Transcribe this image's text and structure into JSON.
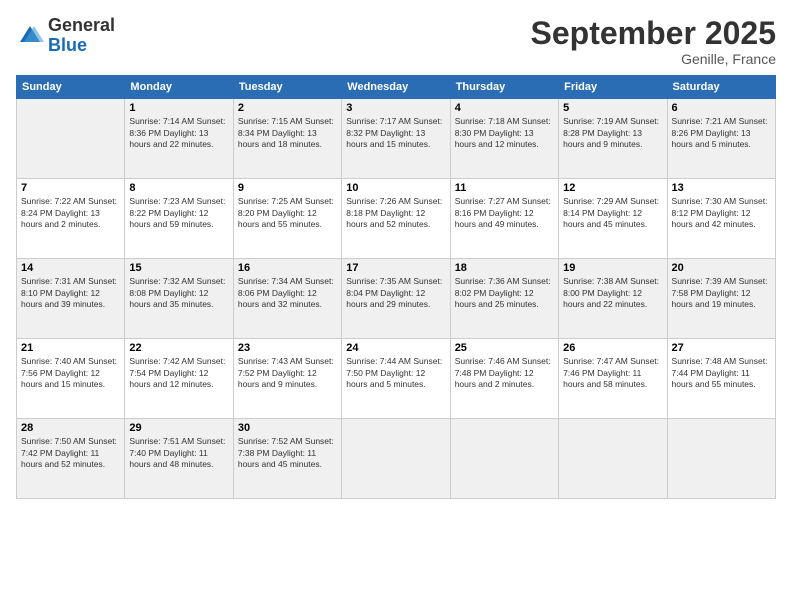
{
  "logo": {
    "general": "General",
    "blue": "Blue"
  },
  "title": "September 2025",
  "subtitle": "Genille, France",
  "days_of_week": [
    "Sunday",
    "Monday",
    "Tuesday",
    "Wednesday",
    "Thursday",
    "Friday",
    "Saturday"
  ],
  "weeks": [
    [
      {
        "day": "",
        "info": ""
      },
      {
        "day": "1",
        "info": "Sunrise: 7:14 AM\nSunset: 8:36 PM\nDaylight: 13 hours\nand 22 minutes."
      },
      {
        "day": "2",
        "info": "Sunrise: 7:15 AM\nSunset: 8:34 PM\nDaylight: 13 hours\nand 18 minutes."
      },
      {
        "day": "3",
        "info": "Sunrise: 7:17 AM\nSunset: 8:32 PM\nDaylight: 13 hours\nand 15 minutes."
      },
      {
        "day": "4",
        "info": "Sunrise: 7:18 AM\nSunset: 8:30 PM\nDaylight: 13 hours\nand 12 minutes."
      },
      {
        "day": "5",
        "info": "Sunrise: 7:19 AM\nSunset: 8:28 PM\nDaylight: 13 hours\nand 9 minutes."
      },
      {
        "day": "6",
        "info": "Sunrise: 7:21 AM\nSunset: 8:26 PM\nDaylight: 13 hours\nand 5 minutes."
      }
    ],
    [
      {
        "day": "7",
        "info": "Sunrise: 7:22 AM\nSunset: 8:24 PM\nDaylight: 13 hours\nand 2 minutes."
      },
      {
        "day": "8",
        "info": "Sunrise: 7:23 AM\nSunset: 8:22 PM\nDaylight: 12 hours\nand 59 minutes."
      },
      {
        "day": "9",
        "info": "Sunrise: 7:25 AM\nSunset: 8:20 PM\nDaylight: 12 hours\nand 55 minutes."
      },
      {
        "day": "10",
        "info": "Sunrise: 7:26 AM\nSunset: 8:18 PM\nDaylight: 12 hours\nand 52 minutes."
      },
      {
        "day": "11",
        "info": "Sunrise: 7:27 AM\nSunset: 8:16 PM\nDaylight: 12 hours\nand 49 minutes."
      },
      {
        "day": "12",
        "info": "Sunrise: 7:29 AM\nSunset: 8:14 PM\nDaylight: 12 hours\nand 45 minutes."
      },
      {
        "day": "13",
        "info": "Sunrise: 7:30 AM\nSunset: 8:12 PM\nDaylight: 12 hours\nand 42 minutes."
      }
    ],
    [
      {
        "day": "14",
        "info": "Sunrise: 7:31 AM\nSunset: 8:10 PM\nDaylight: 12 hours\nand 39 minutes."
      },
      {
        "day": "15",
        "info": "Sunrise: 7:32 AM\nSunset: 8:08 PM\nDaylight: 12 hours\nand 35 minutes."
      },
      {
        "day": "16",
        "info": "Sunrise: 7:34 AM\nSunset: 8:06 PM\nDaylight: 12 hours\nand 32 minutes."
      },
      {
        "day": "17",
        "info": "Sunrise: 7:35 AM\nSunset: 8:04 PM\nDaylight: 12 hours\nand 29 minutes."
      },
      {
        "day": "18",
        "info": "Sunrise: 7:36 AM\nSunset: 8:02 PM\nDaylight: 12 hours\nand 25 minutes."
      },
      {
        "day": "19",
        "info": "Sunrise: 7:38 AM\nSunset: 8:00 PM\nDaylight: 12 hours\nand 22 minutes."
      },
      {
        "day": "20",
        "info": "Sunrise: 7:39 AM\nSunset: 7:58 PM\nDaylight: 12 hours\nand 19 minutes."
      }
    ],
    [
      {
        "day": "21",
        "info": "Sunrise: 7:40 AM\nSunset: 7:56 PM\nDaylight: 12 hours\nand 15 minutes."
      },
      {
        "day": "22",
        "info": "Sunrise: 7:42 AM\nSunset: 7:54 PM\nDaylight: 12 hours\nand 12 minutes."
      },
      {
        "day": "23",
        "info": "Sunrise: 7:43 AM\nSunset: 7:52 PM\nDaylight: 12 hours\nand 9 minutes."
      },
      {
        "day": "24",
        "info": "Sunrise: 7:44 AM\nSunset: 7:50 PM\nDaylight: 12 hours\nand 5 minutes."
      },
      {
        "day": "25",
        "info": "Sunrise: 7:46 AM\nSunset: 7:48 PM\nDaylight: 12 hours\nand 2 minutes."
      },
      {
        "day": "26",
        "info": "Sunrise: 7:47 AM\nSunset: 7:46 PM\nDaylight: 11 hours\nand 58 minutes."
      },
      {
        "day": "27",
        "info": "Sunrise: 7:48 AM\nSunset: 7:44 PM\nDaylight: 11 hours\nand 55 minutes."
      }
    ],
    [
      {
        "day": "28",
        "info": "Sunrise: 7:50 AM\nSunset: 7:42 PM\nDaylight: 11 hours\nand 52 minutes."
      },
      {
        "day": "29",
        "info": "Sunrise: 7:51 AM\nSunset: 7:40 PM\nDaylight: 11 hours\nand 48 minutes."
      },
      {
        "day": "30",
        "info": "Sunrise: 7:52 AM\nSunset: 7:38 PM\nDaylight: 11 hours\nand 45 minutes."
      },
      {
        "day": "",
        "info": ""
      },
      {
        "day": "",
        "info": ""
      },
      {
        "day": "",
        "info": ""
      },
      {
        "day": "",
        "info": ""
      }
    ]
  ]
}
